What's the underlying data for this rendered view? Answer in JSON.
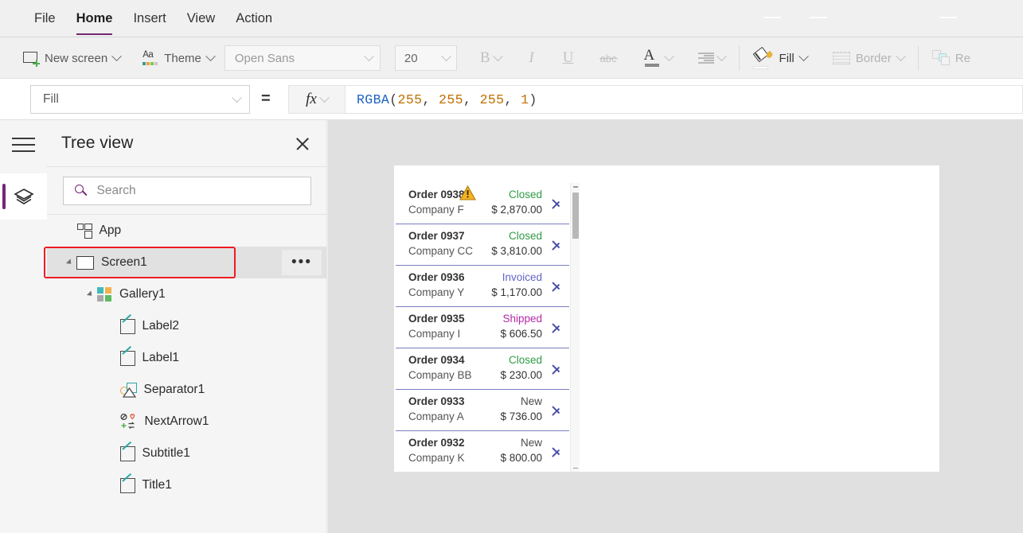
{
  "menu": {
    "items": [
      {
        "label": "File",
        "active": false
      },
      {
        "label": "Home",
        "active": true
      },
      {
        "label": "Insert",
        "active": false
      },
      {
        "label": "View",
        "active": false
      },
      {
        "label": "Action",
        "active": false
      }
    ]
  },
  "ribbon": {
    "new_screen": "New screen",
    "theme": "Theme",
    "font_family_value": "Open Sans",
    "font_size_value": "20",
    "bold": "B",
    "italic": "I",
    "underline": "U",
    "strikethrough": "abc",
    "font_color": "A",
    "fill": "Fill",
    "border": "Border",
    "reorder": "Re"
  },
  "formula_bar": {
    "property_value": "Fill",
    "equals": "=",
    "fx": "fx",
    "formula_function": "RGBA",
    "formula_args": [
      "255",
      "255",
      "255",
      "1"
    ],
    "formula_full": "RGBA(255, 255, 255, 1)"
  },
  "tree_panel": {
    "title": "Tree view",
    "search_placeholder": "Search",
    "search_value": "",
    "more_label": "•••",
    "items": [
      {
        "label": "App",
        "icon": "app-icon",
        "indent": 0,
        "caret": false,
        "selected": false
      },
      {
        "label": "Screen1",
        "icon": "screen-icon",
        "indent": 0,
        "caret": true,
        "selected": true
      },
      {
        "label": "Gallery1",
        "icon": "gallery-icon",
        "indent": 1,
        "caret": true,
        "selected": false
      },
      {
        "label": "Label2",
        "icon": "label-icon",
        "indent": 2,
        "caret": false,
        "selected": false
      },
      {
        "label": "Label1",
        "icon": "label-icon",
        "indent": 2,
        "caret": false,
        "selected": false
      },
      {
        "label": "Separator1",
        "icon": "separator-icon",
        "indent": 2,
        "caret": false,
        "selected": false
      },
      {
        "label": "NextArrow1",
        "icon": "nextarrow-icon",
        "indent": 2,
        "caret": false,
        "selected": false
      },
      {
        "label": "Subtitle1",
        "icon": "label-icon",
        "indent": 2,
        "caret": false,
        "selected": false
      },
      {
        "label": "Title1",
        "icon": "label-icon",
        "indent": 2,
        "caret": false,
        "selected": false
      }
    ]
  },
  "canvas": {
    "gallery_rows": [
      {
        "title": "Order 0938",
        "company": "Company F",
        "status": "Closed",
        "status_color": "#2e9b44",
        "amount": "$ 2,870.00",
        "warning": true
      },
      {
        "title": "Order 0937",
        "company": "Company CC",
        "status": "Closed",
        "status_color": "#2e9b44",
        "amount": "$ 3,810.00",
        "warning": false
      },
      {
        "title": "Order 0936",
        "company": "Company Y",
        "status": "Invoiced",
        "status_color": "#6264c8",
        "amount": "$ 1,170.00",
        "warning": false
      },
      {
        "title": "Order 0935",
        "company": "Company I",
        "status": "Shipped",
        "status_color": "#b52aa8",
        "amount": "$ 606.50",
        "warning": false
      },
      {
        "title": "Order 0934",
        "company": "Company BB",
        "status": "Closed",
        "status_color": "#2e9b44",
        "amount": "$ 230.00",
        "warning": false
      },
      {
        "title": "Order 0933",
        "company": "Company A",
        "status": "New",
        "status_color": "#4a4a4a",
        "amount": "$ 736.00",
        "warning": false
      },
      {
        "title": "Order 0932",
        "company": "Company K",
        "status": "New",
        "status_color": "#4a4a4a",
        "amount": "$ 800.00",
        "warning": false
      }
    ]
  },
  "colors": {
    "accent": "#742774",
    "selection_outline": "#ed1c24",
    "chevron": "#4a4fa8",
    "warning": "#f5b324"
  }
}
